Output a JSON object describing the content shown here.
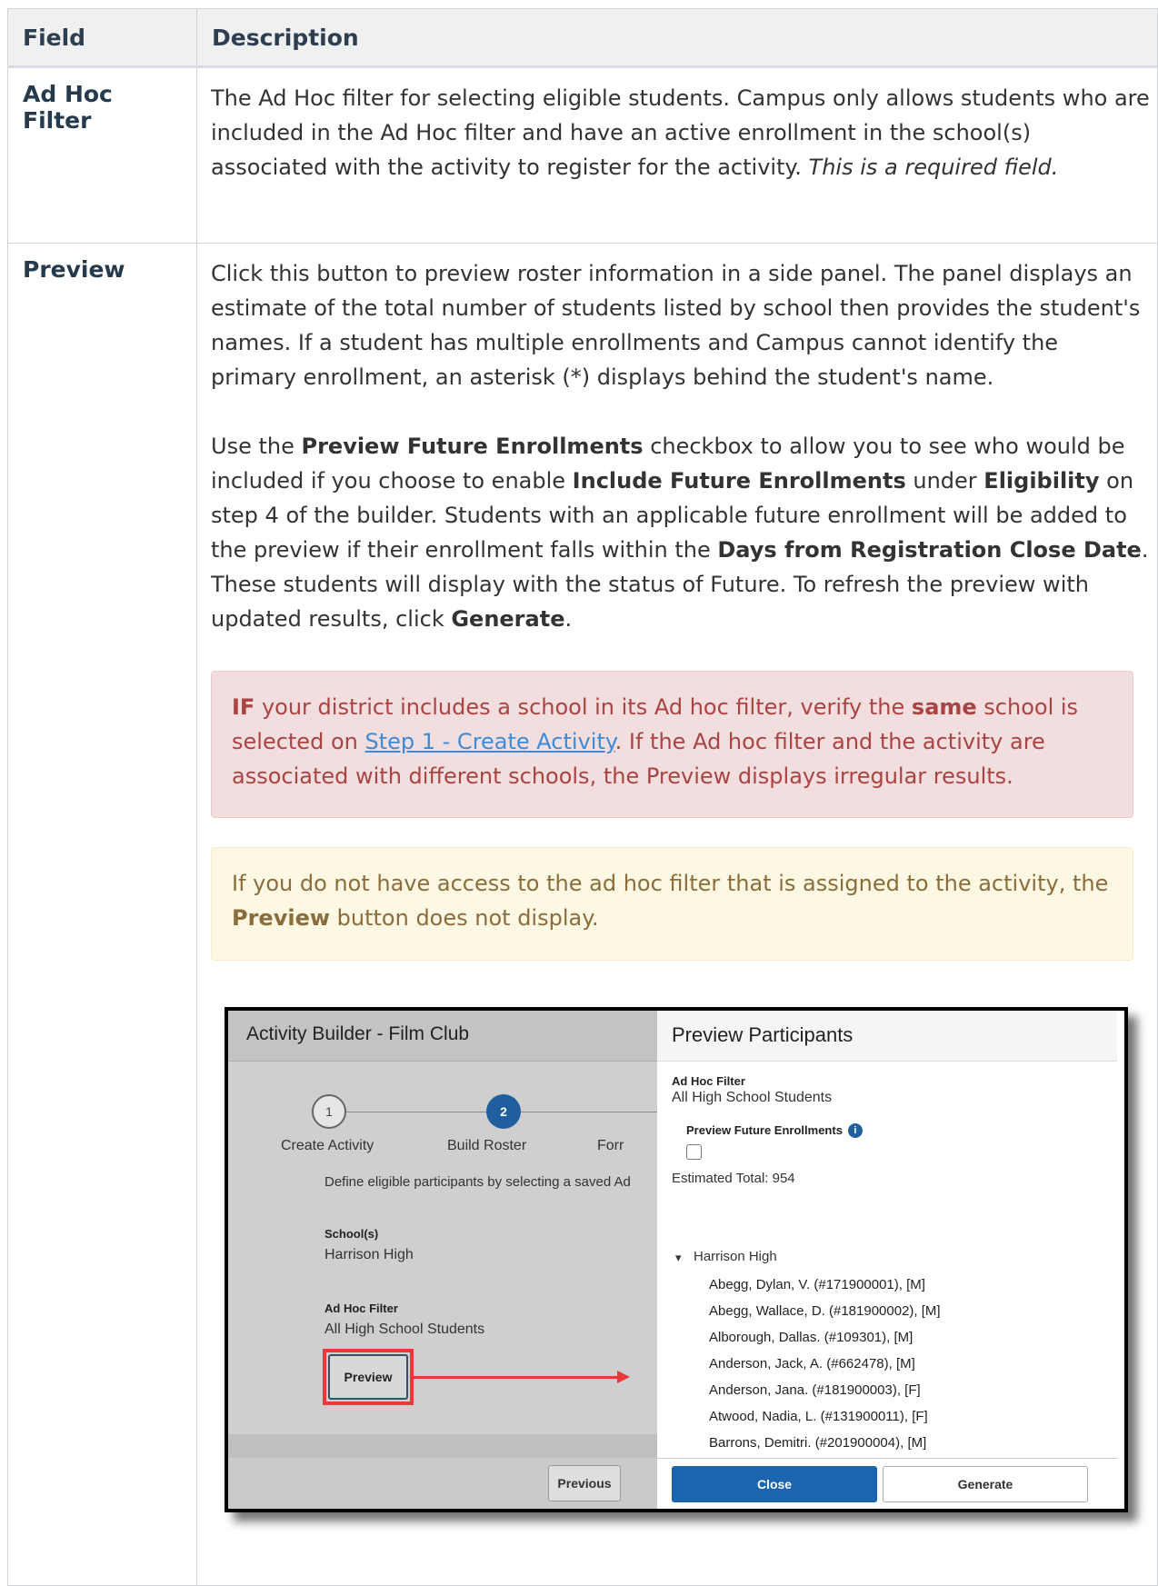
{
  "table": {
    "headers": [
      "Field",
      "Description"
    ],
    "row_adhoc": {
      "field": "Ad Hoc Filter",
      "desc_text": "The Ad Hoc filter for selecting eligible students. Campus only allows students who are included in the Ad Hoc filter and have an active enrollment in the school(s) associated with the activity to register for the activity.",
      "desc_italic": "This is a required field."
    },
    "row_preview": {
      "field": "Preview",
      "para1": "Click this button to preview roster information in a side panel. The panel displays an estimate of the total number of students listed by school then provides the student's names. If a student has multiple enrollments and Campus cannot identify the primary enrollment, an asterisk (*) displays behind the student's name.",
      "para2": {
        "t1": "Use the ",
        "b1": "Preview Future Enrollments",
        "t2": " checkbox to allow you to see who would be included if you choose to enable ",
        "b2": "Include Future Enrollments",
        "t3": " under ",
        "b3": "Eligibility",
        "t4": " on step 4 of the builder. Students with an applicable future enrollment will be added to the preview if their enrollment falls within the ",
        "b4": "Days from Registration Close Date",
        "t5": ". These students will display with the status of Future. To refresh the preview with updated results, click ",
        "b5": "Generate",
        "t6": "."
      },
      "danger": {
        "b1": "IF",
        "t1": " your district includes a school in its Ad hoc filter, verify the ",
        "b2": "same",
        "t2": " school is selected on ",
        "link": "Step 1 - Create Activity",
        "t3": ". If the Ad hoc filter and the activity are associated with different schools, the Preview displays irregular results."
      },
      "warning": {
        "t1": "If you do not have access to the ad hoc filter that is assigned to the activity, the ",
        "b1": "Preview",
        "t2": " button does not display."
      }
    }
  },
  "screenshot": {
    "left": {
      "title": "Activity Builder - Film Club",
      "step1_num": "1",
      "step1_label": "Create Activity",
      "step2_num": "2",
      "step2_label": "Build Roster",
      "step3_label_partial": "Forr",
      "instruction": "Define eligible participants by selecting a saved Ad",
      "school_label": "School(s)",
      "school_value": "Harrison High",
      "adhoc_label": "Ad Hoc Filter",
      "adhoc_value": "All High School Students",
      "preview_button": "Preview",
      "previous_button": "Previous"
    },
    "right": {
      "title": "Preview Participants",
      "adhoc_label": "Ad Hoc Filter",
      "adhoc_value": "All High School Students",
      "future_label": "Preview Future Enrollments",
      "info_icon": "i",
      "estimated": "Estimated Total: 954",
      "expand_glyph": "▾",
      "school": "Harrison High",
      "students": [
        "Abegg, Dylan, V. (#171900001), [M]",
        "Abegg, Wallace, D. (#181900002), [M]",
        "Alborough, Dallas. (#109301), [M]",
        "Anderson, Jack, A. (#662478), [M]",
        "Anderson, Jana. (#181900003), [F]",
        "Atwood, Nadia, L. (#131900011), [F]",
        "Barrons, Demitri. (#201900004), [M]"
      ],
      "close_button": "Close",
      "generate_button": "Generate"
    }
  }
}
